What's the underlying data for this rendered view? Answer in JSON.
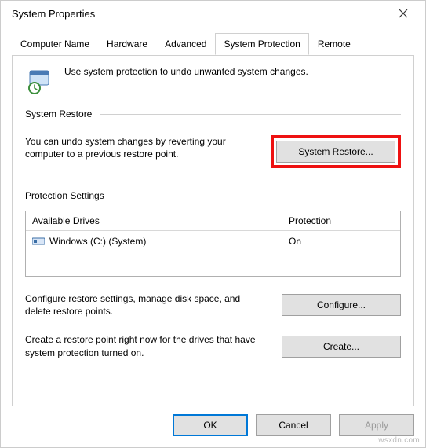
{
  "window": {
    "title": "System Properties"
  },
  "tabs": {
    "computer_name": "Computer Name",
    "hardware": "Hardware",
    "advanced": "Advanced",
    "system_protection": "System Protection",
    "remote": "Remote"
  },
  "intro": {
    "text": "Use system protection to undo unwanted system changes."
  },
  "restore_section": {
    "heading": "System Restore",
    "description": "You can undo system changes by reverting your computer to a previous restore point.",
    "button": "System Restore..."
  },
  "protection_section": {
    "heading": "Protection Settings",
    "columns": {
      "drives": "Available Drives",
      "protection": "Protection"
    },
    "rows": [
      {
        "name": "Windows (C:) (System)",
        "protection": "On"
      }
    ],
    "configure_text": "Configure restore settings, manage disk space, and delete restore points.",
    "configure_button": "Configure...",
    "create_text": "Create a restore point right now for the drives that have system protection turned on.",
    "create_button": "Create..."
  },
  "buttons": {
    "ok": "OK",
    "cancel": "Cancel",
    "apply": "Apply"
  },
  "watermark": "wsxdn.com"
}
